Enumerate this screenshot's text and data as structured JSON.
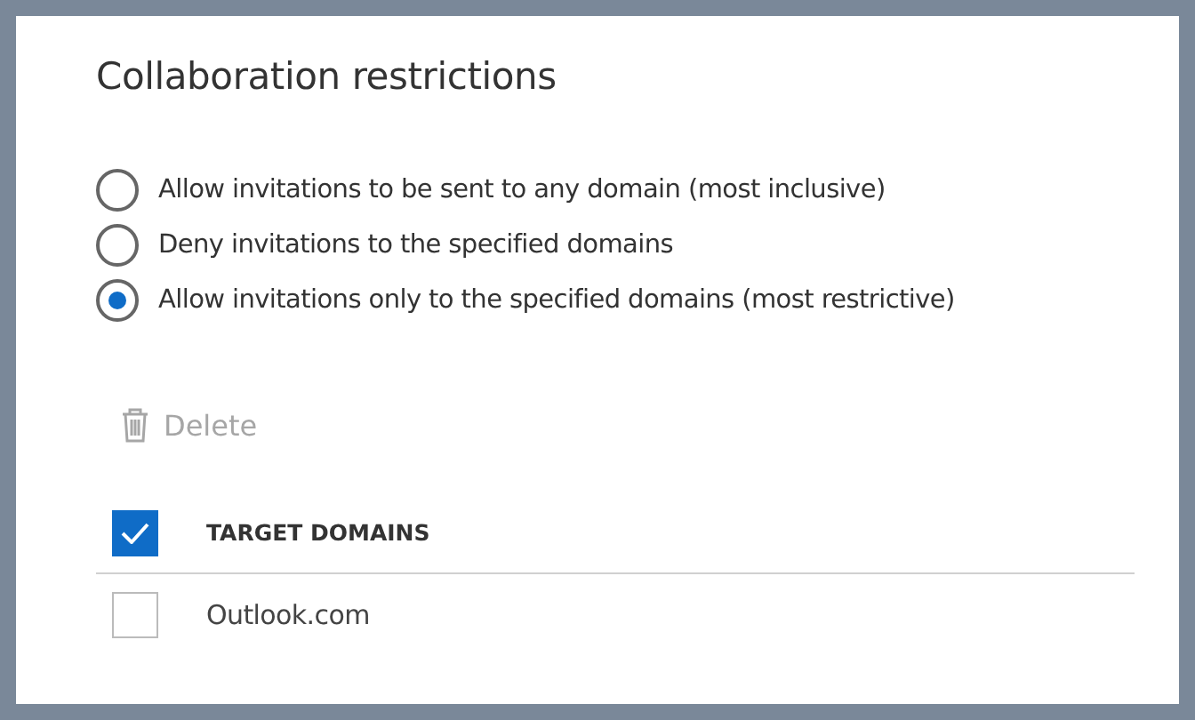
{
  "title": "Collaboration restrictions",
  "options": [
    {
      "label": "Allow invitations to be sent to any domain (most inclusive)",
      "selected": false
    },
    {
      "label": "Deny invitations to the specified domains",
      "selected": false
    },
    {
      "label": "Allow invitations only to the specified domains (most restrictive)",
      "selected": true
    }
  ],
  "delete_button": {
    "label": "Delete",
    "disabled": true
  },
  "table": {
    "header": {
      "label": "TARGET DOMAINS",
      "checked": true
    },
    "rows": [
      {
        "label": "Outlook.com",
        "checked": false
      }
    ]
  }
}
